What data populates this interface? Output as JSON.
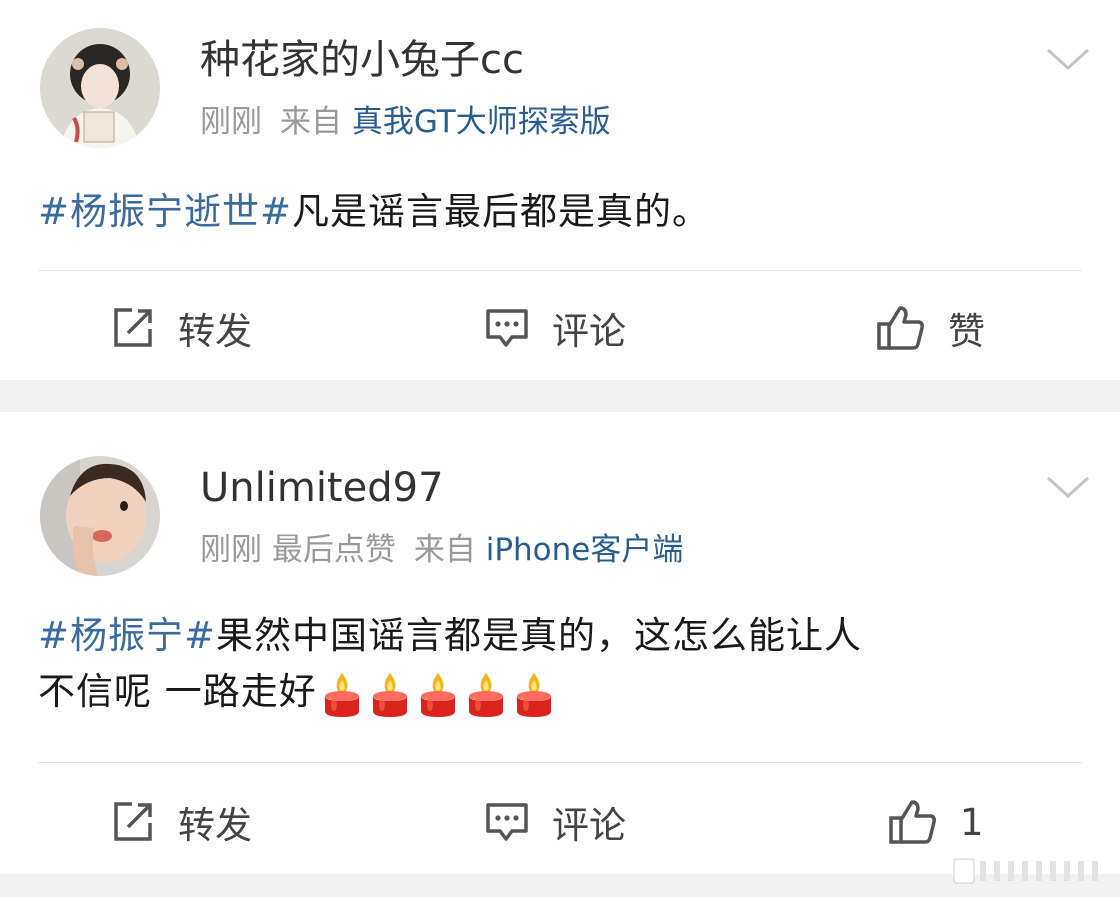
{
  "posts": [
    {
      "username": "种花家的小兔子cc",
      "time": "刚刚",
      "extra": "",
      "from_label": "来自",
      "source": "真我GT大师探索版",
      "hashtag": "#杨振宁逝世#",
      "text": "凡是谣言最后都是真的。",
      "text_line2": "",
      "actions": {
        "repost": "转发",
        "comment": "评论",
        "like": "赞"
      }
    },
    {
      "username": "Unlimited97",
      "time": "刚刚",
      "extra": "最后点赞",
      "from_label": "来自",
      "source": "iPhone客户端",
      "hashtag": "#杨振宁#",
      "text": "果然中国谣言都是真的，这怎么能让人",
      "text_line2": "不信呢 一路走好",
      "candle_count": 5,
      "actions": {
        "repost": "转发",
        "comment": "评论",
        "like": "1"
      }
    }
  ],
  "icons": {
    "avatar_1": "avatar-opera-woman",
    "avatar_2": "avatar-child",
    "more": "chevron-down-icon",
    "repost": "repost-icon",
    "comment": "comment-icon",
    "like": "thumbs-up-icon",
    "candle": "candle-emoji"
  },
  "colors": {
    "link": "#3b6a9c",
    "source": "#2a5d8f",
    "meta": "#999999",
    "text": "#1a1a1a",
    "separator": "#f2f2f2"
  }
}
